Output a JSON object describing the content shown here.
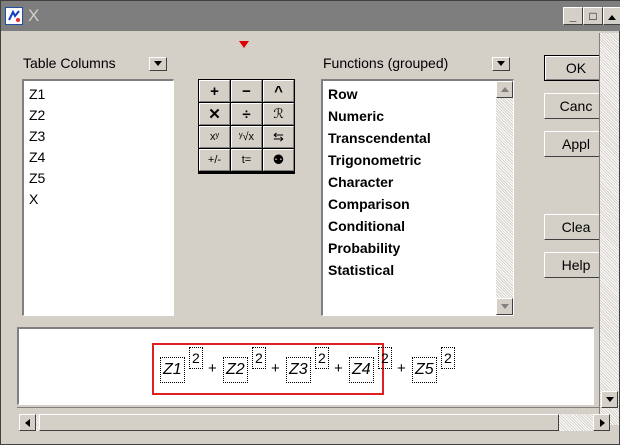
{
  "window": {
    "title": "X",
    "minimize": "_",
    "maximize": "□"
  },
  "table_columns": {
    "label": "Table Columns",
    "items": [
      "Z1",
      "Z2",
      "Z3",
      "Z4",
      "Z5",
      "X"
    ]
  },
  "keypad": {
    "keys": [
      {
        "label": "+",
        "icon": "plus-key"
      },
      {
        "label": "−",
        "icon": "minus-key"
      },
      {
        "label": "^",
        "icon": "caret-key"
      },
      {
        "label": "✕",
        "icon": "multiply-key"
      },
      {
        "label": "÷",
        "icon": "divide-key"
      },
      {
        "label": "ℛ",
        "icon": "root-swap-key"
      },
      {
        "label": "xʸ",
        "icon": "power-key"
      },
      {
        "label": "ʸ√x",
        "icon": "nth-root-key"
      },
      {
        "label": "⇆",
        "icon": "swap-key"
      },
      {
        "label": "+/-",
        "icon": "negate-key"
      },
      {
        "label": "t=",
        "icon": "assign-key"
      },
      {
        "label": "⚉",
        "icon": "clear-term-key"
      }
    ]
  },
  "functions": {
    "label": "Functions (grouped)",
    "items": [
      "Row",
      "Numeric",
      "Transcendental",
      "Trigonometric",
      "Character",
      "Comparison",
      "Conditional",
      "Probability",
      "Statistical"
    ]
  },
  "buttons": {
    "ok": "OK",
    "cancel": "Canc",
    "apply": "Appl",
    "clear": "Clea",
    "help": "Help"
  },
  "formula": {
    "terms": [
      "Z1",
      "Z2",
      "Z3",
      "Z4",
      "Z5"
    ],
    "exponent": "2",
    "operator": "+"
  },
  "colors": {
    "titlebar": "#7e7e7e",
    "formula_border": "#e02020",
    "marker": "#e00000"
  }
}
